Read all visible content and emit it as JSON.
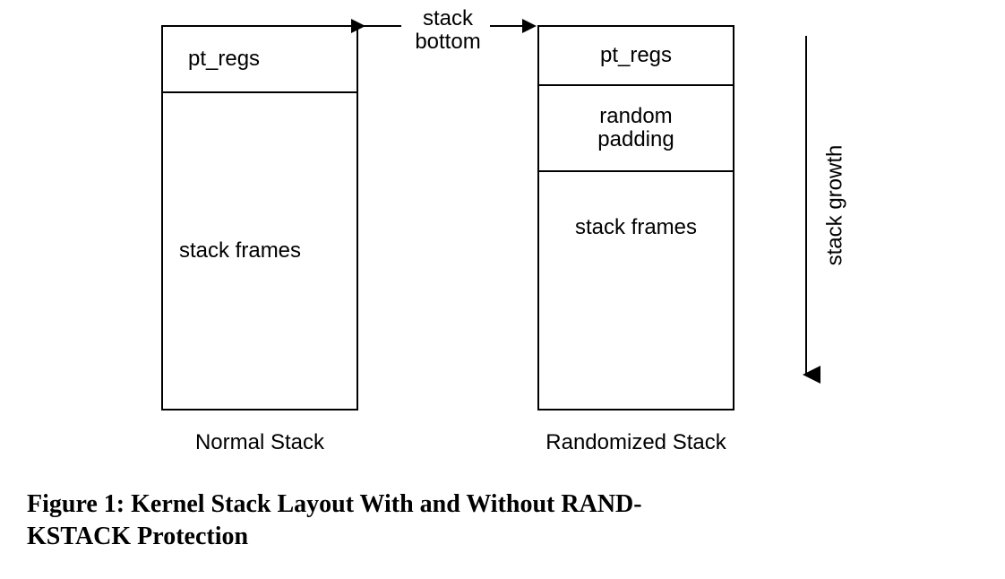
{
  "topLabel": "stack bottom",
  "leftStack": {
    "ptRegs": "pt_regs",
    "frames": "stack frames",
    "label": "Normal Stack"
  },
  "rightStack": {
    "ptRegs": "pt_regs",
    "padding": "random\npadding",
    "frames": "stack frames",
    "label": "Randomized Stack"
  },
  "growthLabel": "stack growth",
  "caption": "Figure 1: Kernel Stack Layout With and Without RANDKSTACK Protection"
}
